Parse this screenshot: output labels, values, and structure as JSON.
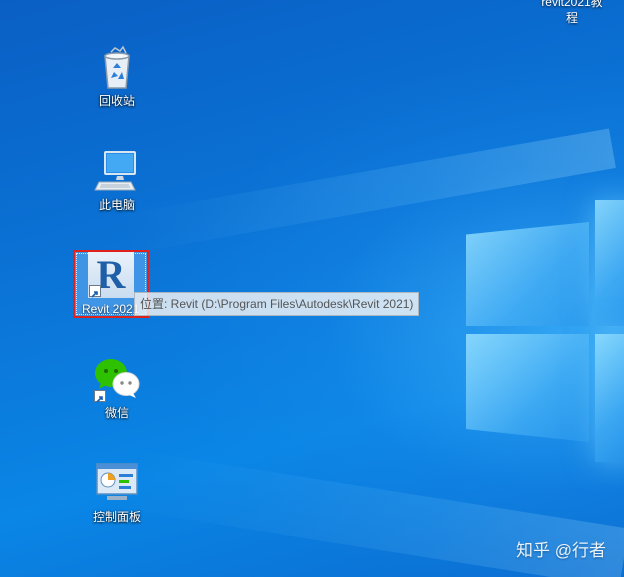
{
  "desktop": {
    "top_right_item": {
      "line1": "revit2021教",
      "line2": "程"
    },
    "icons": {
      "recycle_bin": "回收站",
      "this_pc": "此电脑",
      "revit": "Revit 2021",
      "wechat": "微信",
      "control_panel": "控制面板"
    },
    "revit_tile_letter": "R",
    "tooltip": "位置: Revit (D:\\Program Files\\Autodesk\\Revit 2021)",
    "watermark": "知乎 @行者"
  },
  "colors": {
    "selection_border": "#e0221c",
    "desktop_blue": "#0b77d9",
    "revit_letter": "#1e5fa8",
    "wechat_green": "#2dc100"
  },
  "icon_names": [
    "recycle-bin-icon",
    "computer-icon",
    "revit-app-icon",
    "wechat-icon",
    "control-panel-icon",
    "shortcut-arrow-icon"
  ]
}
